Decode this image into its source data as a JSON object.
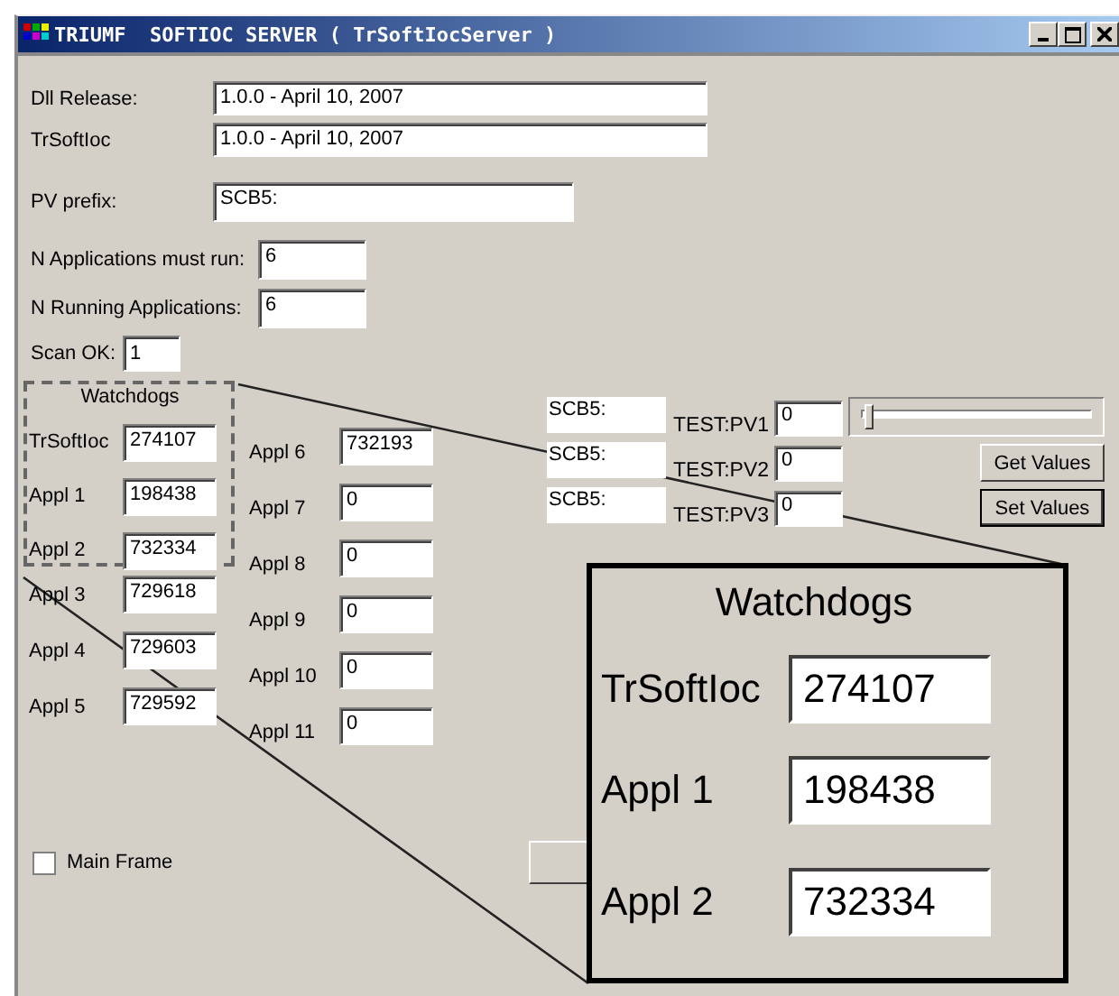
{
  "window": {
    "title": "TRIUMF  SOFTIOC SERVER ( TrSoftIocServer )"
  },
  "info_fields": [
    {
      "label": "Dll Release:",
      "value": "1.0.0 - April 10, 2007"
    },
    {
      "label": "TrSoftIoc",
      "value": "1.0.0 - April 10, 2007"
    },
    {
      "label": "PV prefix:",
      "value": "SCB5:"
    },
    {
      "label": "N Applications must run:",
      "value": "6"
    },
    {
      "label": "N Running Applications:",
      "value": "6"
    },
    {
      "label": "Scan OK:",
      "value": "1"
    }
  ],
  "watchdogs": {
    "title": "Watchdogs",
    "column_1": [
      {
        "label": "TrSoftIoc",
        "value": "274107"
      },
      {
        "label": "Appl 1",
        "value": "198438"
      },
      {
        "label": "Appl 2",
        "value": "732334"
      },
      {
        "label": "Appl 3",
        "value": "729618"
      },
      {
        "label": "Appl 4",
        "value": "729603"
      },
      {
        "label": "Appl 5",
        "value": "729592"
      }
    ],
    "column_2": [
      {
        "label": "Appl 6",
        "value": "732193"
      },
      {
        "label": "Appl 7",
        "value": "0"
      },
      {
        "label": "Appl 8",
        "value": "0"
      },
      {
        "label": "Appl 9",
        "value": "0"
      },
      {
        "label": "Appl 10",
        "value": "0"
      },
      {
        "label": "Appl 11",
        "value": "0"
      }
    ]
  },
  "pv_rows": [
    {
      "prefix": "SCB5:",
      "name": "TEST:PV1",
      "value": "0"
    },
    {
      "prefix": "SCB5:",
      "name": "TEST:PV2",
      "value": "0"
    },
    {
      "prefix": "SCB5:",
      "name": "TEST:PV3",
      "value": "0"
    }
  ],
  "slider": {
    "level": 0.03
  },
  "buttons": [
    "Get Values",
    "Set Values"
  ],
  "main_frame": {
    "label": "Main Frame",
    "checked": false
  },
  "magnified_inset": {
    "title": "Watchdogs",
    "rows": [
      {
        "label": "TrSoftIoc",
        "value": "274107"
      },
      {
        "label": "Appl 1",
        "value": "198438"
      },
      {
        "label": "Appl 2",
        "value": "732334"
      }
    ]
  }
}
